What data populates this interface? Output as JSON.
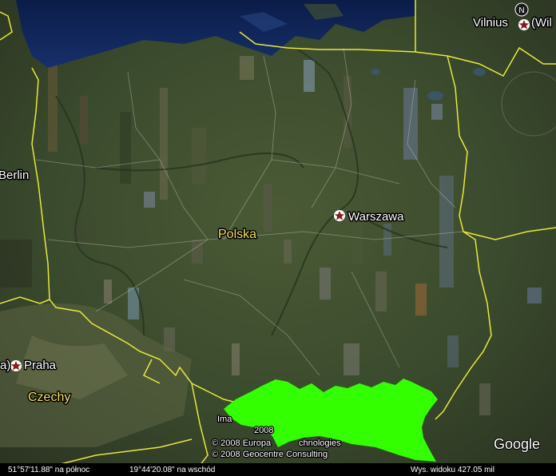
{
  "map": {
    "countries": {
      "poland": "Polska",
      "czech": "Czechy"
    },
    "cities": {
      "warsaw": "Warszawa",
      "berlin": "Berlin",
      "prague": "Praha",
      "prague_prefix": "a)",
      "vilnius": "Vilnius",
      "vilnius_suffix": "(Wil"
    },
    "compass_letter": "N",
    "credits": {
      "image_prefix": "Ima",
      "year_fragment": "2008",
      "line1_left": "© 2008 Europa",
      "line1_right": "chnologies",
      "line2": "© 2008 Geocentre Consulting"
    },
    "logo": "Google"
  },
  "status_bar": {
    "latitude": "51°57'11.88\" na północ",
    "longitude": "19°44'20.08\" na wschód",
    "altitude": "Wys. widoku   427.05 mil"
  },
  "colors": {
    "border": "#e8e83a",
    "highlight_region": "#33ff00",
    "sea": "#0d2150",
    "terrain": "#3b4a2c",
    "status_bar": "#000000"
  }
}
